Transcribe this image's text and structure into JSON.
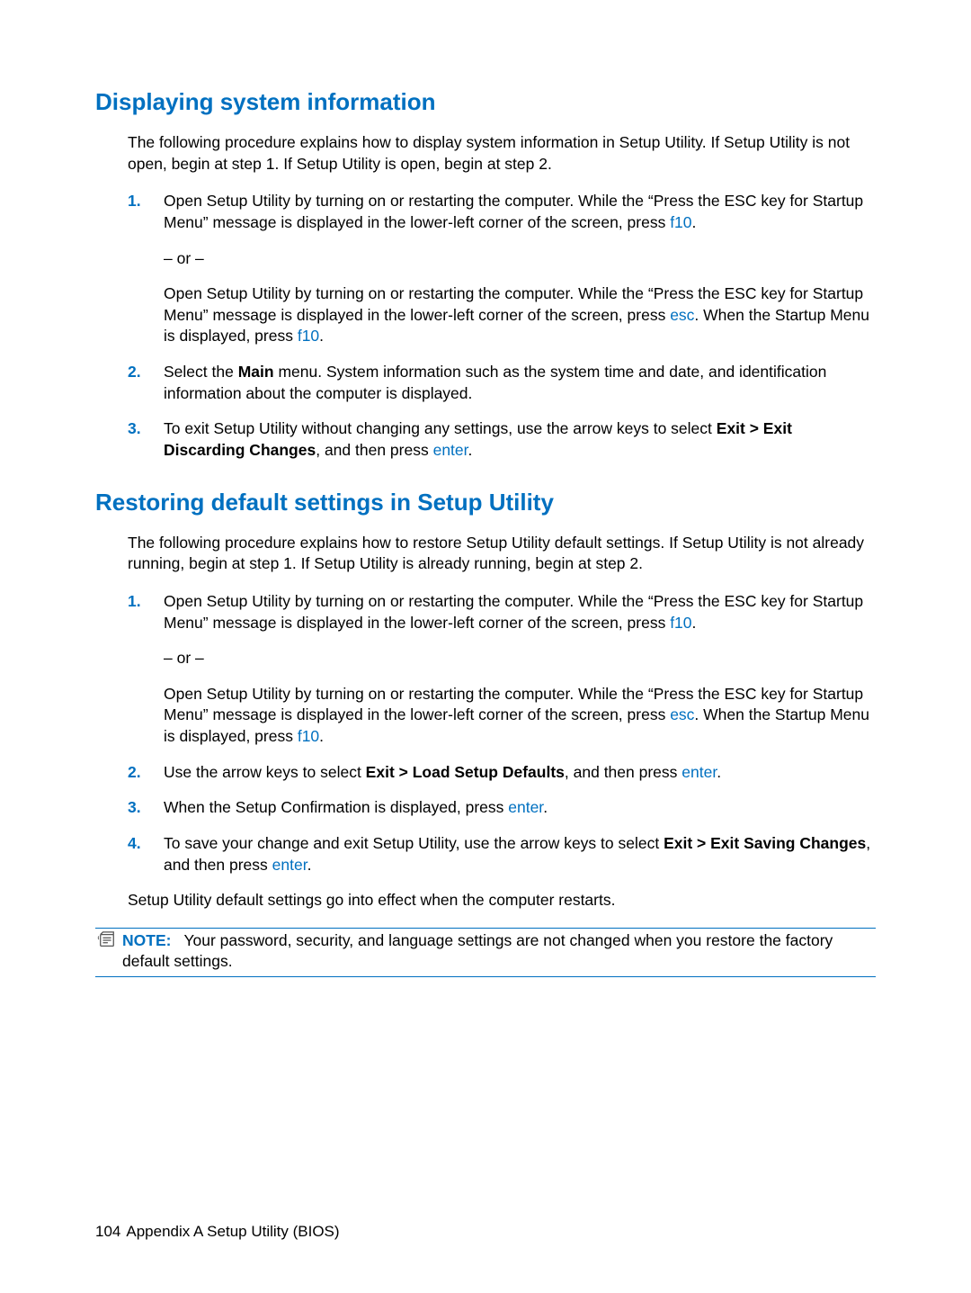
{
  "section1": {
    "heading": "Displaying system information",
    "intro": "The following procedure explains how to display system information in Setup Utility. If Setup Utility is not open, begin at step 1. If Setup Utility is open, begin at step 2.",
    "steps": {
      "s1": {
        "num": "1.",
        "p1a": "Open Setup Utility by turning on or restarting the computer. While the “Press the ESC key for Startup Menu” message is displayed in the lower-left corner of the screen, press ",
        "k1": "f10",
        "p1b": ".",
        "or": "– or –",
        "p2a": "Open Setup Utility by turning on or restarting the computer. While the “Press the ESC key for Startup Menu” message is displayed in the lower-left corner of the screen, press ",
        "k2": "esc",
        "p2b": ". When the Startup Menu is displayed, press ",
        "k3": "f10",
        "p2c": "."
      },
      "s2": {
        "num": "2.",
        "a": "Select the ",
        "b": "Main",
        "c": " menu. System information such as the system time and date, and identification information about the computer is displayed."
      },
      "s3": {
        "num": "3.",
        "a": "To exit Setup Utility without changing any settings, use the arrow keys to select ",
        "b": "Exit > Exit Discarding Changes",
        "c": ", and then press ",
        "k": "enter",
        "d": "."
      }
    }
  },
  "section2": {
    "heading": "Restoring default settings in Setup Utility",
    "intro": "The following procedure explains how to restore Setup Utility default settings. If Setup Utility is not already running, begin at step 1. If Setup Utility is already running, begin at step 2.",
    "steps": {
      "s1": {
        "num": "1.",
        "p1a": "Open Setup Utility by turning on or restarting the computer. While the “Press the ESC key for Startup Menu” message is displayed in the lower-left corner of the screen, press ",
        "k1": "f10",
        "p1b": ".",
        "or": "– or –",
        "p2a": "Open Setup Utility by turning on or restarting the computer. While the “Press the ESC key for Startup Menu” message is displayed in the lower-left corner of the screen, press ",
        "k2": "esc",
        "p2b": ". When the Startup Menu is displayed, press ",
        "k3": "f10",
        "p2c": "."
      },
      "s2": {
        "num": "2.",
        "a": "Use the arrow keys to select ",
        "b": "Exit > Load Setup Defaults",
        "c": ", and then press ",
        "k": "enter",
        "d": "."
      },
      "s3": {
        "num": "3.",
        "a": "When the Setup Confirmation is displayed, press ",
        "k": "enter",
        "b": "."
      },
      "s4": {
        "num": "4.",
        "a": "To save your change and exit Setup Utility, use the arrow keys to select ",
        "b": "Exit > Exit Saving Changes",
        "c": ", and then press ",
        "k": "enter",
        "d": "."
      }
    },
    "after": "Setup Utility default settings go into effect when the computer restarts.",
    "note": {
      "label": "NOTE:",
      "text": "Your password, security, and language settings are not changed when you restore the factory default settings."
    }
  },
  "footer": {
    "pagenum": "104",
    "text": "Appendix A   Setup Utility (BIOS)"
  }
}
